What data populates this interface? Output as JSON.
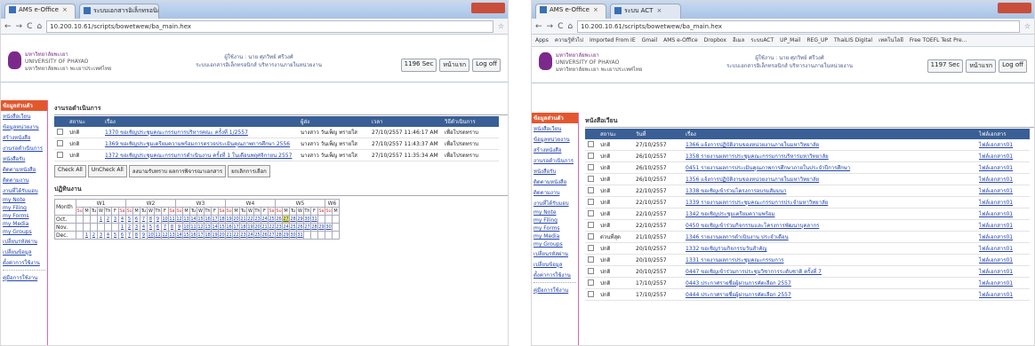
{
  "left": {
    "tabs": [
      {
        "label": "AMS e-Office",
        "close": "×"
      },
      {
        "label": "ระบบเอกสารอิเล็กทรอนิกส์",
        "close": "×"
      }
    ],
    "url": "10.200.10.61/scripts/bowetwew/ba_main.hex",
    "university": {
      "th": "มหาวิทยาลัยพะเยา",
      "en": "UNIVERSITY OF PHAYAO",
      "sub": "มหาวิทยาลัยพะเยา พะเยาประเทศไทย"
    },
    "system": {
      "line1": "ผู้ใช้งาน : นาย ศุภวิทย์ ศรีวงศ์",
      "line2": "ระบบเอกสารอิเล็กทรอนิกส์ บริหารงานภายในหน่วยงาน"
    },
    "header_buttons": [
      "1196 Sec",
      "หน้าแรก",
      "Log off"
    ],
    "section_docs": "งานรอดำเนินการ",
    "docs_headers": [
      "",
      "สถานะ",
      "เรื่อง",
      "ผู้ส่ง",
      "เวลา",
      "วิธีดำเนินการ"
    ],
    "docs": [
      {
        "status": "ปกติ",
        "subject": "1370 ขอเชิญประชุมคณะกรรมการบริหารคณะ ครั้งที่ 1/2557",
        "from": "นางสาว วันเพ็ญ ทรายใส",
        "time": "27/10/2557 11:46:17 AM",
        "action": "เพื่อโปรดทราบ"
      },
      {
        "status": "ปกติ",
        "subject": "1369 ขอเชิญประชุมเตรียมความพร้อมการตรวจประเมินคุณภาพการศึกษา 2556",
        "from": "นางสาว วันเพ็ญ ทรายใส",
        "time": "27/10/2557 11:43:37 AM",
        "action": "เพื่อโปรดทราบ"
      },
      {
        "status": "ปกติ",
        "subject": "1372 ขอเชิญประชุมคณะกรรมการดำเนินงาน ครั้งที่ 1 ในเดือนพฤศจิกายน 2557",
        "from": "นางสาว วันเพ็ญ ทรายใส",
        "time": "27/10/2557 11:35:34 AM",
        "action": "เพื่อโปรดทราบ"
      }
    ],
    "action_buttons": [
      "Check All",
      "UnCheck All",
      "ลงนามรับทราบ ผลการพิจารณาเอกสาร",
      "ยกเลิกการเลือก"
    ],
    "section_calendar": "ปฏิทินงาน",
    "calendar": {
      "month_label": "Month",
      "weeks": [
        "W1",
        "W2",
        "W3",
        "W4",
        "W5",
        "W6"
      ],
      "days": [
        "Su",
        "M",
        "Tu",
        "W",
        "Th",
        "F",
        "Sa"
      ],
      "months": [
        {
          "name": "Oct.",
          "lead": 3,
          "count": 31
        },
        {
          "name": "Nov.",
          "lead": 6,
          "count": 30
        },
        {
          "name": "Dec.",
          "lead": 1,
          "count": 31
        }
      ],
      "today": "27"
    }
  },
  "right": {
    "tabs": [
      {
        "label": "AMS e-Office",
        "close": "×"
      },
      {
        "label": "ระบบ ACT",
        "close": "×"
      }
    ],
    "url": "10.200.10.61/scripts/bowetwew/ba_main.hex",
    "bookmarks": [
      "Apps",
      "ความรู้ทั่วไป",
      "Imported From IE",
      "Gmail",
      "AMS e-Office",
      "Dropbox",
      "อีเมล",
      "ระบบACT",
      "UP_Mail",
      "REG_UP",
      "ThaiLIS Digital",
      "เทคโนโลยี",
      "Free TOEFL Test Pre..."
    ],
    "university": {
      "th": "มหาวิทยาลัยพะเยา",
      "en": "UNIVERSITY OF PHAYAO",
      "sub": "มหาวิทยาลัยพะเยา พะเยาประเทศไทย"
    },
    "system": {
      "line1": "ผู้ใช้งาน : นาย ศุภวิทย์ ศรีวงศ์",
      "line2": "ระบบเอกสารอิเล็กทรอนิกส์ บริหารงานภายในหน่วยงาน"
    },
    "header_buttons": [
      "1197 Sec",
      "หน้าแรก",
      "Log off"
    ],
    "section_docs": "หนังสือเวียน",
    "docs_headers": [
      "",
      "สถานะ",
      "วันที่",
      "เรื่อง",
      "ไฟล์เอกสาร"
    ],
    "docs": [
      {
        "status": "ปกติ",
        "date": "27/10/2557",
        "subject": "1366 แจ้งการปฏิบัติงานของหน่วยงานภายในมหาวิทยาลัย",
        "file": "ไฟล์เอกสาร01"
      },
      {
        "status": "ปกติ",
        "date": "26/10/2557",
        "subject": "1358 รายงานผลการประชุมคณะกรรมการบริหารมหาวิทยาลัย",
        "file": "ไฟล์เอกสาร01"
      },
      {
        "status": "ปกติ",
        "date": "26/10/2557",
        "subject": "0451 รายงานผลการประเมินคุณภาพการศึกษาภายในประจำปีการศึกษา",
        "file": "ไฟล์เอกสาร01"
      },
      {
        "status": "ปกติ",
        "date": "26/10/2557",
        "subject": "1356 แจ้งการปฏิบัติงานของหน่วยงานภายในมหาวิทยาลัย",
        "file": "ไฟล์เอกสาร01"
      },
      {
        "status": "ปกติ",
        "date": "22/10/2557",
        "subject": "1338 ขอเชิญเข้าร่วมโครงการอบรมสัมมนา",
        "file": "ไฟล์เอกสาร01"
      },
      {
        "status": "ปกติ",
        "date": "22/10/2557",
        "subject": "1339 รายงานผลการประชุมคณะกรรมการประจำมหาวิทยาลัย",
        "file": "ไฟล์เอกสาร01"
      },
      {
        "status": "ปกติ",
        "date": "22/10/2557",
        "subject": "1342 ขอเชิญประชุมเตรียมความพร้อม",
        "file": "ไฟล์เอกสาร01"
      },
      {
        "status": "ปกติ",
        "date": "22/10/2557",
        "subject": "0450 ขอเชิญเข้าร่วมกิจกรรมและโครงการพัฒนาบุคลากร",
        "file": "ไฟล์เอกสาร01"
      },
      {
        "status": "ด่วนที่สุด",
        "date": "21/10/2557",
        "subject": "1346 รายงานผลการดำเนินงาน ประจำเดือน",
        "file": "ไฟล์เอกสาร01"
      },
      {
        "status": "ปกติ",
        "date": "20/10/2557",
        "subject": "1332 ขอเชิญร่วมกิจกรรมวันสำคัญ",
        "file": "ไฟล์เอกสาร01"
      },
      {
        "status": "ปกติ",
        "date": "20/10/2557",
        "subject": "1331 รายงานผลการประชุมคณะกรรมการ",
        "file": "ไฟล์เอกสาร01"
      },
      {
        "status": "ปกติ",
        "date": "20/10/2557",
        "subject": "0447 ขอเชิญเข้าร่วมการประชุมวิชาการระดับชาติ ครั้งที่ 7",
        "file": "ไฟล์เอกสาร01"
      },
      {
        "status": "ปกติ",
        "date": "17/10/2557",
        "subject": "0443 ประกาศรายชื่อผู้ผ่านการคัดเลือก 2557",
        "file": "ไฟล์เอกสาร01"
      },
      {
        "status": "ปกติ",
        "date": "17/10/2557",
        "subject": "0444 ประกาศรายชื่อผู้ผ่านการคัดเลือก 2557",
        "file": "ไฟล์เอกสาร01"
      }
    ]
  },
  "sidebar": {
    "head": "ข้อมูลส่วนตัว",
    "items": [
      "หนังสือเวียน",
      "ข้อมูลหน่วยงาน",
      "สร้างหนังสือ",
      "งานรอดำเนินการ",
      "หนังสือรับ",
      "ติดตามหนังสือ",
      "ติดตามงาน",
      "งานที่ได้รับมอบ",
      "my Note",
      "my Filing",
      "my Forms",
      "my Media",
      "my Groups",
      "เปลี่ยนรหัสผ่าน",
      "เปลี่ยนข้อมูล",
      "ตั้งค่าการใช้งาน"
    ],
    "footer": "คู่มือการใช้งาน"
  }
}
